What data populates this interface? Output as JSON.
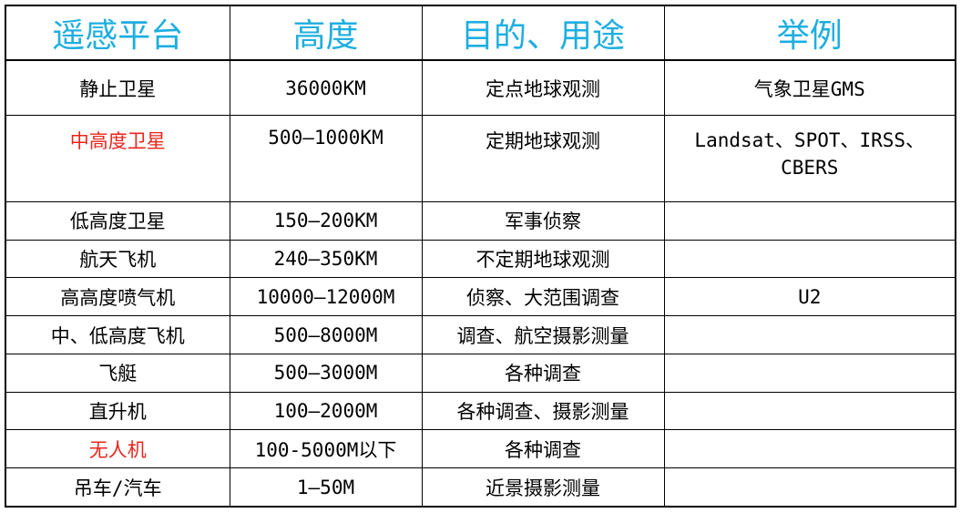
{
  "colors": {
    "header_text": "#1eaee0",
    "highlight_text": "#e8261c"
  },
  "table": {
    "headers": [
      "遥感平台",
      "高度",
      "目的、用途",
      "举例"
    ],
    "rows": [
      {
        "platform": "静止卫星",
        "height": "36000KM",
        "purpose": "定点地球观测",
        "example": "气象卫星GMS",
        "highlight": false
      },
      {
        "platform": "中高度卫星",
        "height": "500—1000KM",
        "purpose": "定期地球观测",
        "example": "Landsat、SPOT、IRSS、CBERS",
        "highlight": true
      },
      {
        "platform": "低高度卫星",
        "height": "150—200KM",
        "purpose": "军事侦察",
        "example": "",
        "highlight": false
      },
      {
        "platform": "航天飞机",
        "height": "240—350KM",
        "purpose": "不定期地球观测",
        "example": "",
        "highlight": false
      },
      {
        "platform": "高高度喷气机",
        "height": "10000—12000M",
        "purpose": "侦察、大范围调查",
        "example": "U2",
        "highlight": false
      },
      {
        "platform": "中、低高度飞机",
        "height": "500—8000M",
        "purpose": "调查、航空摄影测量",
        "example": "",
        "highlight": false
      },
      {
        "platform": "飞艇",
        "height": "500—3000M",
        "purpose": "各种调查",
        "example": "",
        "highlight": false
      },
      {
        "platform": "直升机",
        "height": "100—2000M",
        "purpose": "各种调查、摄影测量",
        "example": "",
        "highlight": false
      },
      {
        "platform": "无人机",
        "height": "100-5000M以下",
        "purpose": "各种调查",
        "example": "",
        "highlight": true
      },
      {
        "platform": "吊车/汽车",
        "height": "1—50M",
        "purpose": "近景摄影测量",
        "example": "",
        "highlight": false
      }
    ]
  }
}
